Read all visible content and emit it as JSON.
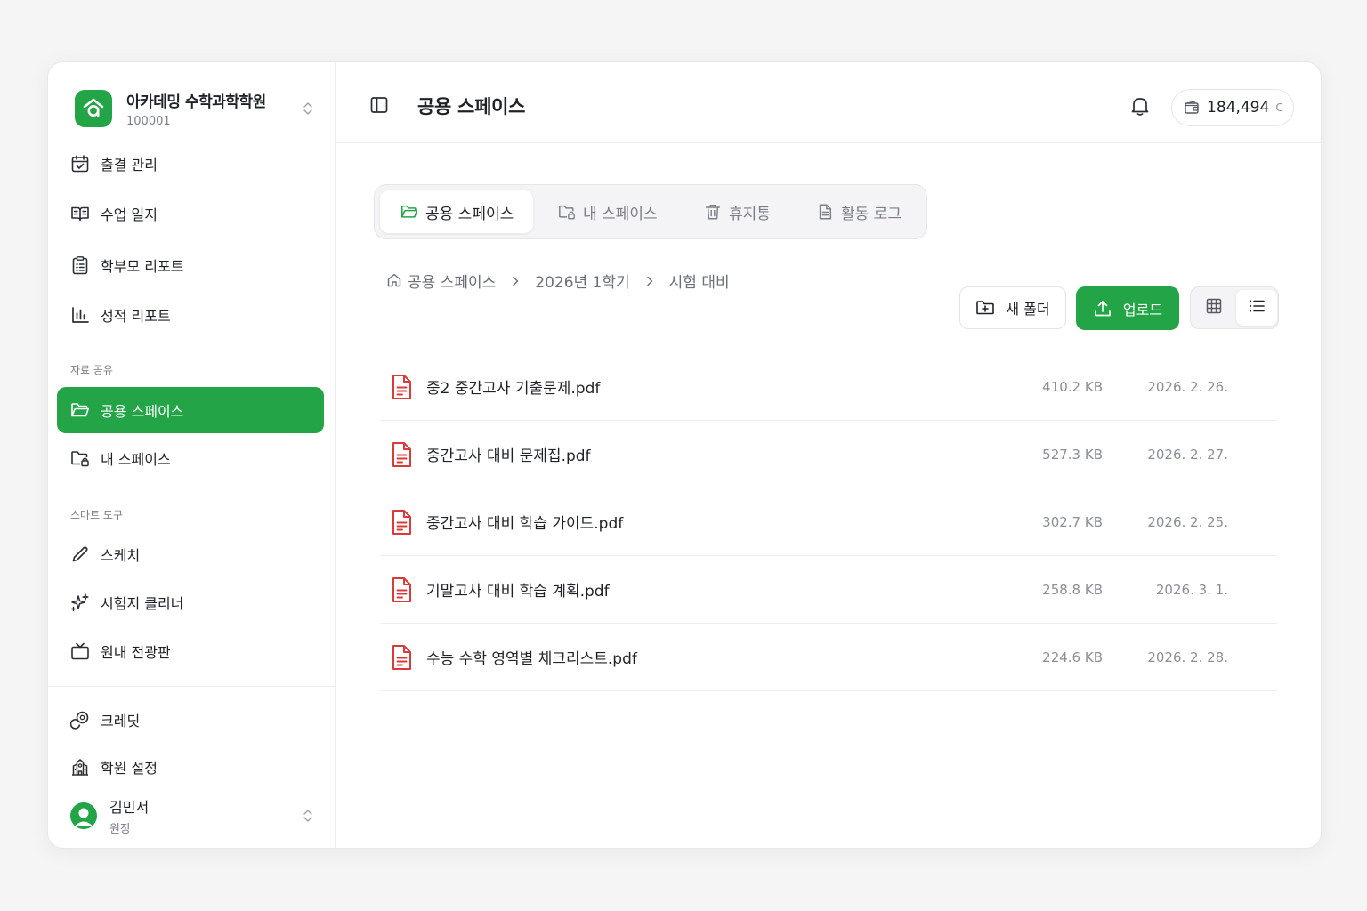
{
  "org": {
    "name": "아카데밍 수학과학학원",
    "id": "100001"
  },
  "sidebar": {
    "items": [
      {
        "label": "출결 관리"
      },
      {
        "label": "수업 일지"
      },
      {
        "label": "학부모 리포트"
      },
      {
        "label": "성적 리포트"
      }
    ],
    "section_share": "자료 공유",
    "share_items": [
      {
        "label": "공용 스페이스",
        "active": true
      },
      {
        "label": "내 스페이스"
      }
    ],
    "section_tools": "스마트 도구",
    "tool_items": [
      {
        "label": "스케치"
      },
      {
        "label": "시험지 클리너"
      },
      {
        "label": "원내 전광판"
      }
    ],
    "bottom_items": [
      {
        "label": "크레딧"
      },
      {
        "label": "학원 설정"
      }
    ]
  },
  "user": {
    "name": "김민서",
    "role": "원장"
  },
  "header": {
    "title": "공용 스페이스",
    "credit_amount": "184,494",
    "credit_unit": "C"
  },
  "tabs": [
    {
      "label": "공용 스페이스",
      "active": true
    },
    {
      "label": "내 스페이스"
    },
    {
      "label": "휴지통"
    },
    {
      "label": "활동 로그"
    }
  ],
  "breadcrumb": [
    "공용 스페이스",
    "2026년 1학기",
    "시험 대비"
  ],
  "toolbar": {
    "new_folder": "새 폴더",
    "upload": "업로드",
    "view_mode": "list"
  },
  "files": [
    {
      "name": "중2 중간고사 기출문제.pdf",
      "size": "410.2 KB",
      "date": "2026. 2. 26."
    },
    {
      "name": "중간고사 대비 문제집.pdf",
      "size": "527.3 KB",
      "date": "2026. 2. 27."
    },
    {
      "name": "중간고사 대비 학습 가이드.pdf",
      "size": "302.7 KB",
      "date": "2026. 2. 25."
    },
    {
      "name": "기말고사 대비 학습 계획.pdf",
      "size": "258.8 KB",
      "date": "2026. 3. 1."
    },
    {
      "name": "수능 수학 영역별 체크리스트.pdf",
      "size": "224.6 KB",
      "date": "2026. 2. 28."
    }
  ],
  "colors": {
    "accent": "#22a447",
    "pdf": "#d93b3b"
  }
}
